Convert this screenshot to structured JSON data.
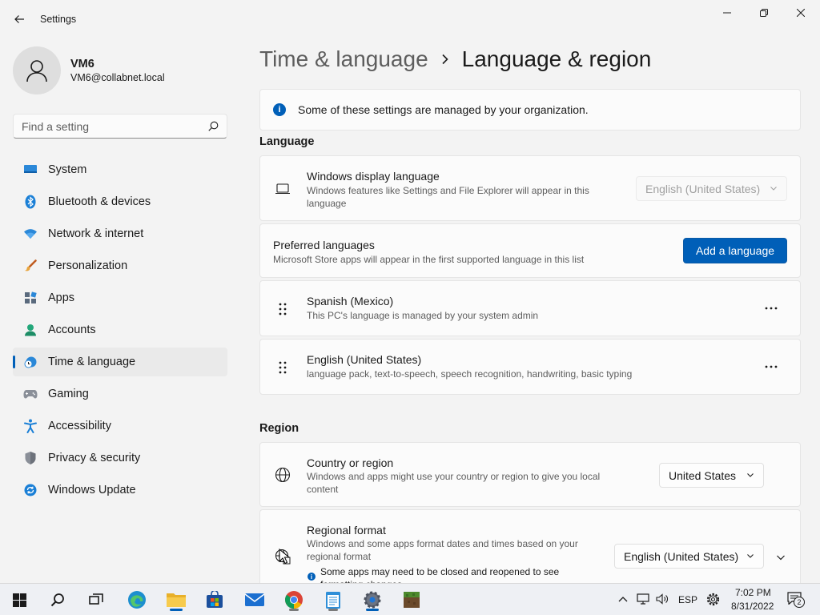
{
  "window": {
    "app_title": "Settings",
    "controls": [
      "minimize",
      "maximize",
      "close"
    ]
  },
  "profile": {
    "name": "VM6",
    "email": "VM6@collabnet.local"
  },
  "search": {
    "placeholder": "Find a setting",
    "value": ""
  },
  "sidebar": {
    "items": [
      {
        "label": "System",
        "icon": "system-icon"
      },
      {
        "label": "Bluetooth & devices",
        "icon": "bluetooth-icon"
      },
      {
        "label": "Network & internet",
        "icon": "wifi-icon"
      },
      {
        "label": "Personalization",
        "icon": "brush-icon"
      },
      {
        "label": "Apps",
        "icon": "apps-icon"
      },
      {
        "label": "Accounts",
        "icon": "accounts-icon"
      },
      {
        "label": "Time & language",
        "icon": "time-language-icon",
        "active": true
      },
      {
        "label": "Gaming",
        "icon": "gamepad-icon"
      },
      {
        "label": "Accessibility",
        "icon": "accessibility-icon"
      },
      {
        "label": "Privacy & security",
        "icon": "shield-icon"
      },
      {
        "label": "Windows Update",
        "icon": "update-icon"
      }
    ]
  },
  "breadcrumb": {
    "parent": "Time & language",
    "current": "Language & region"
  },
  "notice": {
    "text": "Some of these settings are managed by your organization."
  },
  "language": {
    "section_title": "Language",
    "display_language": {
      "title": "Windows display language",
      "description": "Windows features like Settings and File Explorer will appear in this language",
      "value": "English (United States)",
      "disabled": true
    },
    "preferred": {
      "title": "Preferred languages",
      "description": "Microsoft Store apps will appear in the first supported language in this list",
      "button": "Add a language"
    },
    "languages": [
      {
        "name": "Spanish (Mexico)",
        "detail": "This PC's language is managed by your system admin"
      },
      {
        "name": "English (United States)",
        "detail": "language pack, text-to-speech, speech recognition, handwriting, basic typing"
      }
    ]
  },
  "region": {
    "section_title": "Region",
    "country": {
      "title": "Country or region",
      "description": "Windows and apps might use your country or region to give you local content",
      "value": "United States"
    },
    "format": {
      "title": "Regional format",
      "description": "Windows and some apps format dates and times based on your regional format",
      "value": "English (United States)",
      "warning": "Some apps may need to be closed and reopened to see formatting changes"
    }
  },
  "taskbar": {
    "apps": [
      "start",
      "search",
      "task-view",
      "edge",
      "file-explorer",
      "store",
      "mail",
      "chrome",
      "notepad",
      "settings",
      "minecraft"
    ],
    "tray": {
      "input_language": "ESP",
      "time": "7:02 PM",
      "date": "8/31/2022",
      "notifications": "2"
    }
  },
  "colors": {
    "accent": "#005fb8",
    "background": "#f3f3f3",
    "card": "#fbfbfb"
  }
}
